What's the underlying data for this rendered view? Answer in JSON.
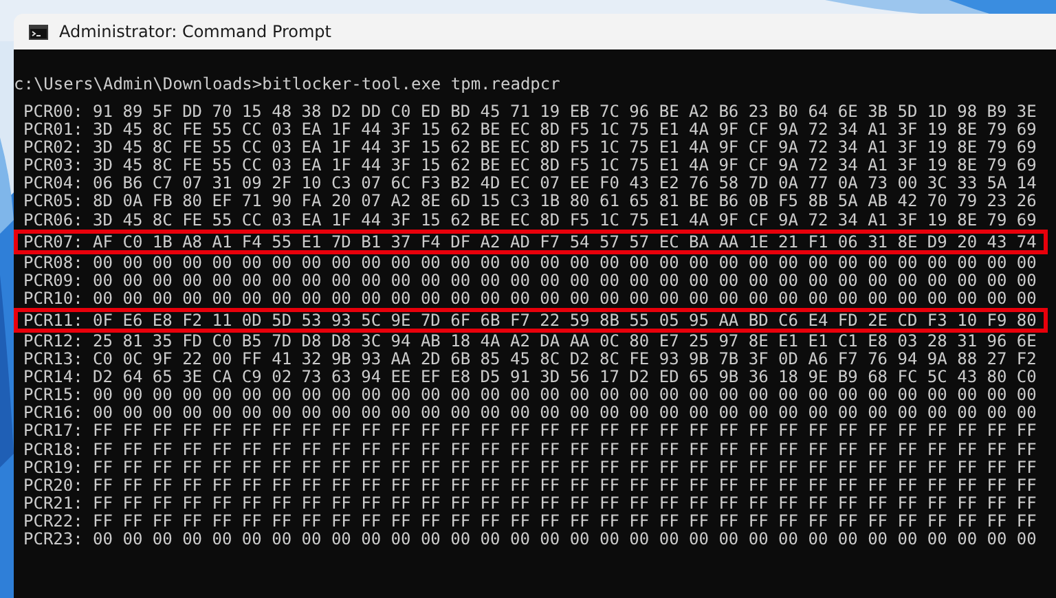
{
  "window": {
    "title": "Administrator: Command Prompt"
  },
  "terminal": {
    "command": "c:\\Users\\Admin\\Downloads>bitlocker-tool.exe tpm.readpcr",
    "rows": [
      {
        "label": "PCR00:",
        "bytes": "91 89 5F DD 70 15 48 38 D2 DD C0 ED BD 45 71 19 EB 7C 96 BE A2 B6 23 B0 64 6E 3B 5D 1D 98 B9 3E",
        "highlighted": false
      },
      {
        "label": "PCR01:",
        "bytes": "3D 45 8C FE 55 CC 03 EA 1F 44 3F 15 62 BE EC 8D F5 1C 75 E1 4A 9F CF 9A 72 34 A1 3F 19 8E 79 69",
        "highlighted": false
      },
      {
        "label": "PCR02:",
        "bytes": "3D 45 8C FE 55 CC 03 EA 1F 44 3F 15 62 BE EC 8D F5 1C 75 E1 4A 9F CF 9A 72 34 A1 3F 19 8E 79 69",
        "highlighted": false
      },
      {
        "label": "PCR03:",
        "bytes": "3D 45 8C FE 55 CC 03 EA 1F 44 3F 15 62 BE EC 8D F5 1C 75 E1 4A 9F CF 9A 72 34 A1 3F 19 8E 79 69",
        "highlighted": false
      },
      {
        "label": "PCR04:",
        "bytes": "06 B6 C7 07 31 09 2F 10 C3 07 6C F3 B2 4D EC 07 EE F0 43 E2 76 58 7D 0A 77 0A 73 00 3C 33 5A 14",
        "highlighted": false
      },
      {
        "label": "PCR05:",
        "bytes": "8D 0A FB 80 EF 71 90 FA 20 07 A2 8E 6D 15 C3 1B 80 61 65 81 BE B6 0B F5 8B 5A AB 42 70 79 23 26",
        "highlighted": false
      },
      {
        "label": "PCR06:",
        "bytes": "3D 45 8C FE 55 CC 03 EA 1F 44 3F 15 62 BE EC 8D F5 1C 75 E1 4A 9F CF 9A 72 34 A1 3F 19 8E 79 69",
        "highlighted": false
      },
      {
        "label": "PCR07:",
        "bytes": "AF C0 1B A8 A1 F4 55 E1 7D B1 37 F4 DF A2 AD F7 54 57 57 EC BA AA 1E 21 F1 06 31 8E D9 20 43 74",
        "highlighted": true
      },
      {
        "label": "PCR08:",
        "bytes": "00 00 00 00 00 00 00 00 00 00 00 00 00 00 00 00 00 00 00 00 00 00 00 00 00 00 00 00 00 00 00 00",
        "highlighted": false
      },
      {
        "label": "PCR09:",
        "bytes": "00 00 00 00 00 00 00 00 00 00 00 00 00 00 00 00 00 00 00 00 00 00 00 00 00 00 00 00 00 00 00 00",
        "highlighted": false
      },
      {
        "label": "PCR10:",
        "bytes": "00 00 00 00 00 00 00 00 00 00 00 00 00 00 00 00 00 00 00 00 00 00 00 00 00 00 00 00 00 00 00 00",
        "highlighted": false
      },
      {
        "label": "PCR11:",
        "bytes": "0F E6 E8 F2 11 0D 5D 53 93 5C 9E 7D 6F 6B F7 22 59 8B 55 05 95 AA BD C6 E4 FD 2E CD F3 10 F9 80",
        "highlighted": true
      },
      {
        "label": "PCR12:",
        "bytes": "25 81 35 FD C0 B5 7D D8 D8 3C 94 AB 18 4A A2 DA AA 0C 80 E7 25 97 8E E1 E1 C1 E8 03 28 31 96 6E",
        "highlighted": false
      },
      {
        "label": "PCR13:",
        "bytes": "C0 0C 9F 22 00 FF 41 32 9B 93 AA 2D 6B 85 45 8C D2 8C FE 93 9B 7B 3F 0D A6 F7 76 94 9A 88 27 F2",
        "highlighted": false
      },
      {
        "label": "PCR14:",
        "bytes": "D2 64 65 3E CA C9 02 73 63 94 EE EF E8 D5 91 3D 56 17 D2 ED 65 9B 36 18 9E B9 68 FC 5C 43 80 C0",
        "highlighted": false
      },
      {
        "label": "PCR15:",
        "bytes": "00 00 00 00 00 00 00 00 00 00 00 00 00 00 00 00 00 00 00 00 00 00 00 00 00 00 00 00 00 00 00 00",
        "highlighted": false
      },
      {
        "label": "PCR16:",
        "bytes": "00 00 00 00 00 00 00 00 00 00 00 00 00 00 00 00 00 00 00 00 00 00 00 00 00 00 00 00 00 00 00 00",
        "highlighted": false
      },
      {
        "label": "PCR17:",
        "bytes": "FF FF FF FF FF FF FF FF FF FF FF FF FF FF FF FF FF FF FF FF FF FF FF FF FF FF FF FF FF FF FF FF",
        "highlighted": false
      },
      {
        "label": "PCR18:",
        "bytes": "FF FF FF FF FF FF FF FF FF FF FF FF FF FF FF FF FF FF FF FF FF FF FF FF FF FF FF FF FF FF FF FF",
        "highlighted": false
      },
      {
        "label": "PCR19:",
        "bytes": "FF FF FF FF FF FF FF FF FF FF FF FF FF FF FF FF FF FF FF FF FF FF FF FF FF FF FF FF FF FF FF FF",
        "highlighted": false
      },
      {
        "label": "PCR20:",
        "bytes": "FF FF FF FF FF FF FF FF FF FF FF FF FF FF FF FF FF FF FF FF FF FF FF FF FF FF FF FF FF FF FF FF",
        "highlighted": false
      },
      {
        "label": "PCR21:",
        "bytes": "FF FF FF FF FF FF FF FF FF FF FF FF FF FF FF FF FF FF FF FF FF FF FF FF FF FF FF FF FF FF FF FF",
        "highlighted": false
      },
      {
        "label": "PCR22:",
        "bytes": "FF FF FF FF FF FF FF FF FF FF FF FF FF FF FF FF FF FF FF FF FF FF FF FF FF FF FF FF FF FF FF FF",
        "highlighted": false
      },
      {
        "label": "PCR23:",
        "bytes": "00 00 00 00 00 00 00 00 00 00 00 00 00 00 00 00 00 00 00 00 00 00 00 00 00 00 00 00 00 00 00 00",
        "highlighted": false
      }
    ]
  }
}
